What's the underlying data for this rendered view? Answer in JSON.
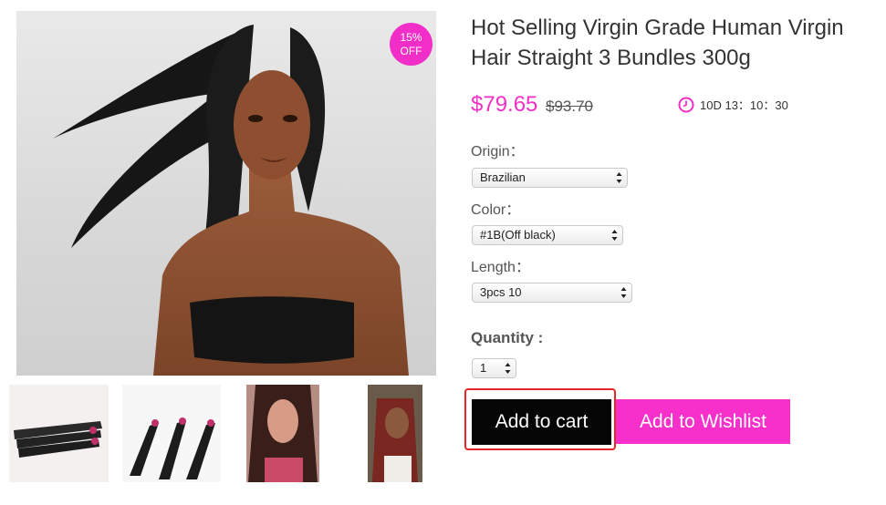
{
  "product": {
    "title": "Hot Selling Virgin Grade Human Virgin Hair Straight 3 Bundles 300g",
    "discount_badge": {
      "percent": "15%",
      "text": "OFF"
    },
    "price_now": "$79.65",
    "price_old": "$93.70",
    "countdown": "10D 13：10：30"
  },
  "options": {
    "origin": {
      "label": "Origin：",
      "value": "Brazilian"
    },
    "color": {
      "label": "Color：",
      "value": "#1B(Off black)"
    },
    "length": {
      "label": "Length：",
      "value": "3pcs 10"
    }
  },
  "quantity": {
    "label": "Quantity :",
    "value": "1"
  },
  "buttons": {
    "add_to_cart": "Add to cart",
    "add_to_wishlist": "Add to Wishlist"
  },
  "colors": {
    "accent_pink": "#f12fc8",
    "wishlist_pink": "#f730cb",
    "cart_black": "#050505",
    "highlight_red": "#e8262a"
  },
  "icons": {
    "timer": "clock-icon",
    "select": "select-arrows-icon"
  }
}
